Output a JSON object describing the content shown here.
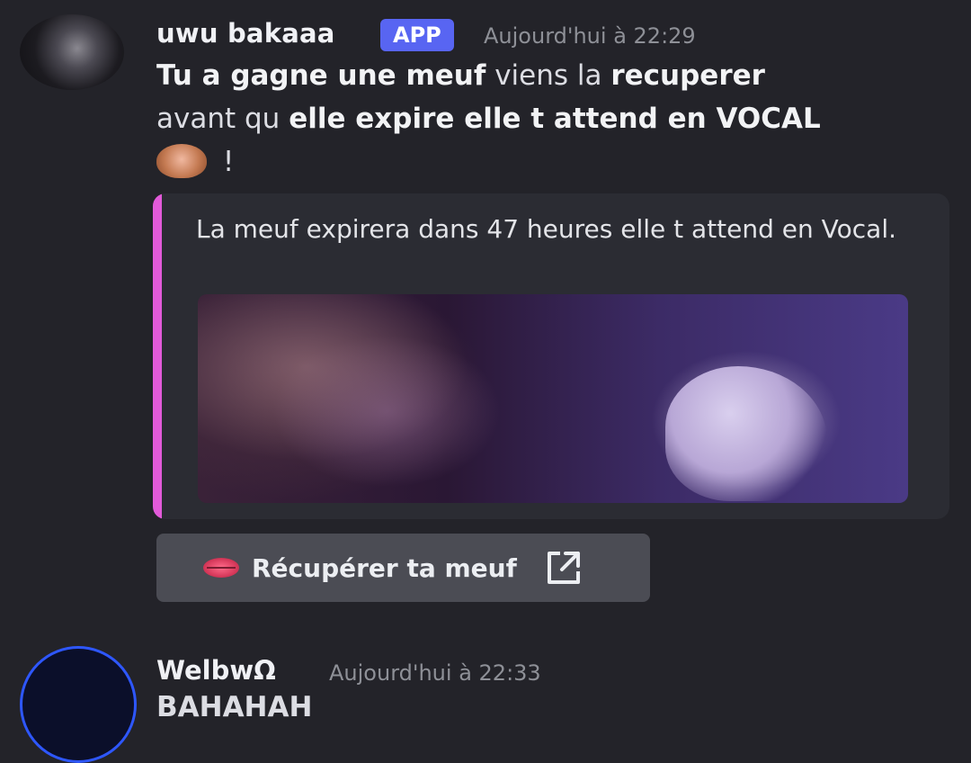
{
  "message1": {
    "username": "uwu bakaaa",
    "badge": "APP",
    "timestamp": "Aujourd'hui à 22:29",
    "text_part1_bold": "Tu a gagne une meuf",
    "text_part2": " viens la ",
    "text_part3_bold": "recuperer",
    "text_part4": "avant qu ",
    "text_part5_bold": "elle expire elle t attend en VOCAL",
    "text_end": " !",
    "emoji": "see-no-evil-monkey"
  },
  "embed": {
    "description": "La meuf expirera dans 47 heures elle t attend en Vocal.",
    "accent_color": "#e25ad9"
  },
  "button": {
    "icon": "lips-icon",
    "label": "Récupérer ta meuf",
    "link_icon": "external-link-icon"
  },
  "message2": {
    "username": "WelbwΩ",
    "timestamp": "Aujourd'hui à 22:33",
    "text": "BAHAHAH"
  },
  "colors": {
    "background": "#232329",
    "app_badge": "#5865f2",
    "button_bg": "#4b4c54"
  }
}
